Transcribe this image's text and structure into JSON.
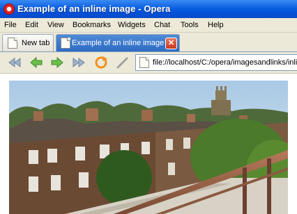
{
  "window": {
    "title": "Example of an inline image - Opera",
    "icon": "opera-logo-icon"
  },
  "menu": {
    "items": [
      "File",
      "Edit",
      "View",
      "Bookmarks",
      "Widgets",
      "Chat",
      "Tools",
      "Help"
    ]
  },
  "tabs": [
    {
      "label": "New tab",
      "icon": "new-tab-icon",
      "active": false
    },
    {
      "label": "Example of an inline image",
      "icon": "page-icon",
      "active": true,
      "close_icon": "close-icon",
      "close_glyph": "✕"
    }
  ],
  "toolbar": {
    "buttons": [
      "rewind-icon",
      "back-icon",
      "forward-icon",
      "fast-forward-icon",
      "reload-icon",
      "edit-pencil-icon"
    ]
  },
  "address": {
    "value": "file://localhost/C:/opera/imagesandlinks/inli"
  },
  "colors": {
    "titlebar": "#0a5fe0",
    "chrome": "#ece9d8",
    "active_tab": "#2d6bc4"
  }
}
